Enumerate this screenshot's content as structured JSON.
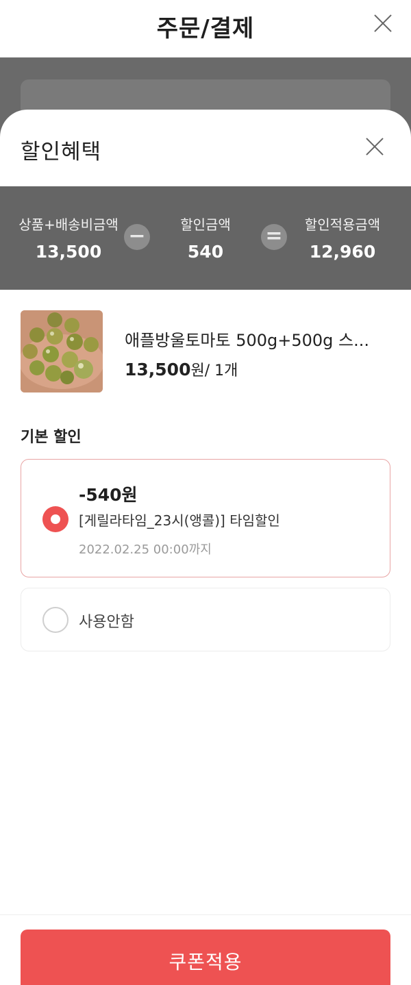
{
  "header": {
    "title": "주문/결제",
    "close_icon": "close-icon"
  },
  "sheet": {
    "title": "할인혜택",
    "close_icon": "close-icon"
  },
  "summary": {
    "product_shipping_label": "상품+배송비금액",
    "product_shipping_value": "13,500",
    "minus_symbol": "−",
    "discount_label": "할인금액",
    "discount_value": "540",
    "equals_symbol": "=",
    "applied_label": "할인적용금액",
    "applied_value": "12,960"
  },
  "product": {
    "image_icon": "tomato-photo",
    "name": "애플방울토마토 500g+500g 스...",
    "price": "13,500",
    "price_unit": "원",
    "quantity": "/ 1개"
  },
  "discount_section": {
    "title": "기본 할인",
    "options": [
      {
        "amount": "-540원",
        "coupon_name": "[게릴라타임_23시(앵콜)] 타임할인",
        "expiry": "2022.02.25 00:00까지",
        "selected": true
      },
      {
        "label": "사용안함",
        "selected": false
      }
    ]
  },
  "footer": {
    "apply_button": "쿠폰적용"
  },
  "colors": {
    "accent": "#ee5252",
    "summary_bg": "#656565",
    "selected_border": "#e8a4a4"
  }
}
